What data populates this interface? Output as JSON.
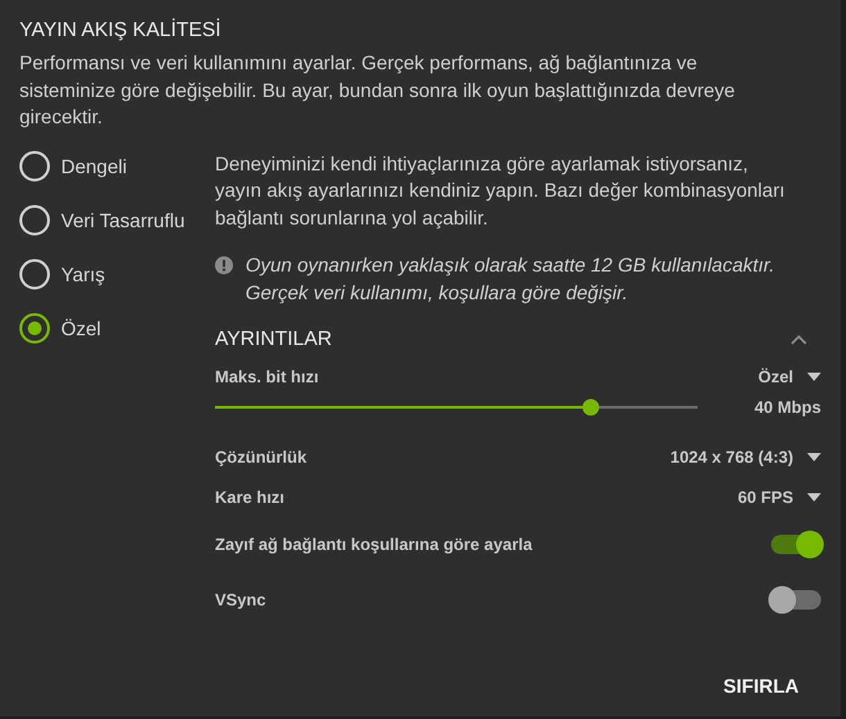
{
  "title": "YAYIN AKIŞ KALİTESİ",
  "description": "Performansı ve veri kullanımını ayarlar. Gerçek performans, ağ bağlantınıza ve sisteminize göre değişebilir. Bu ayar, bundan sonra ilk oyun başlattığınızda devreye girecektir.",
  "presets": [
    {
      "label": "Dengeli",
      "selected": false
    },
    {
      "label": "Veri Tasarruflu",
      "selected": false
    },
    {
      "label": "Yarış",
      "selected": false
    },
    {
      "label": "Özel",
      "selected": true
    }
  ],
  "preset_description": "Deneyiminizi kendi ihtiyaçlarınıza göre ayarlamak istiyorsanız, yayın akış ayarlarınızı kendiniz yapın. Bazı değer kombinasyonları bağlantı sorunlarına yol açabilir.",
  "notice": "Oyun oynanırken yaklaşık olarak saatte 12 GB kullanılacaktır. Gerçek veri kullanımı, koşullara göre değişir.",
  "details": {
    "title": "AYRINTILAR",
    "expanded": true,
    "settings": [
      {
        "kind": "slider",
        "label": "Maks. bit hızı",
        "value": "Özel",
        "level": 0.78,
        "reading": "40 Mbps"
      },
      {
        "kind": "dropdown",
        "label": "Çözünürlük",
        "value": "1024 x 768 (4:3)"
      },
      {
        "kind": "dropdown",
        "label": "Kare hızı",
        "value": "60 FPS"
      },
      {
        "kind": "toggle",
        "label": "Zayıf ağ bağlantı koşullarına göre ayarla",
        "on": true
      },
      {
        "kind": "toggle",
        "label": "VSync",
        "on": false
      }
    ]
  },
  "reset_button": "SIFIRLA"
}
